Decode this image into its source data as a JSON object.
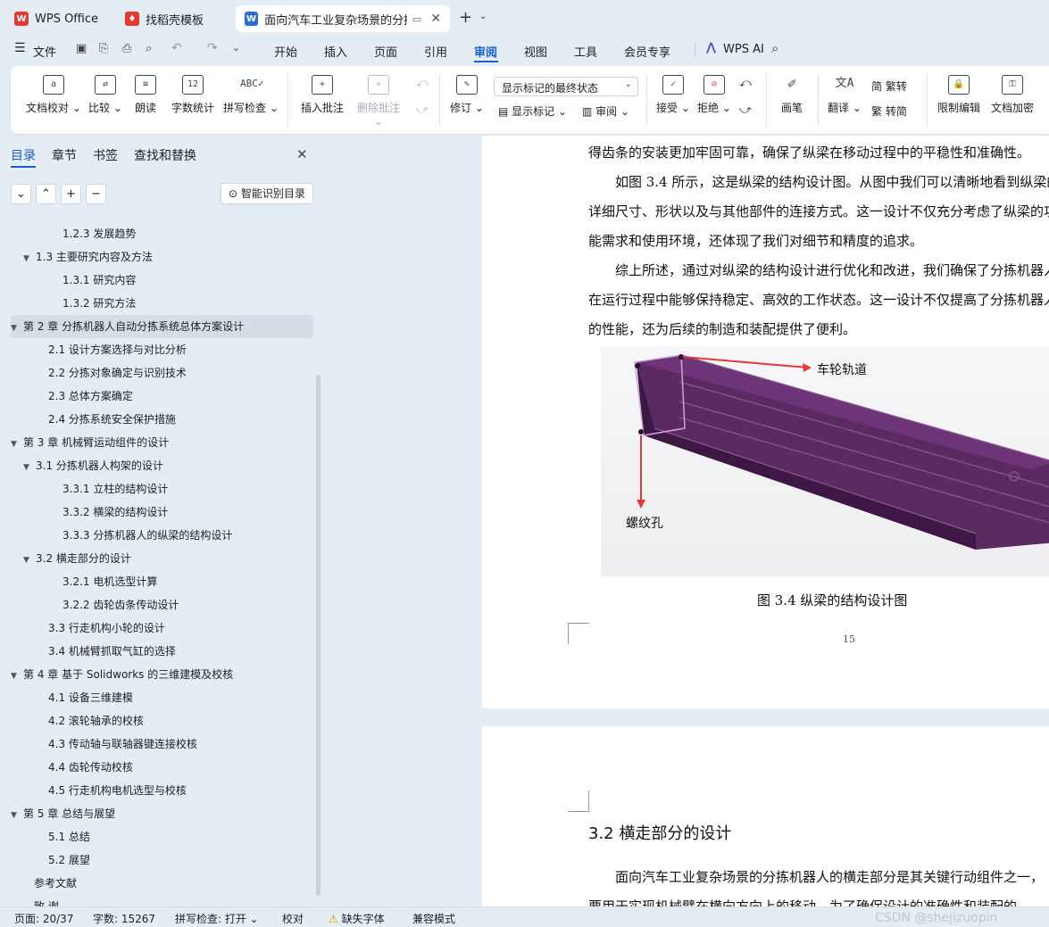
{
  "tabs": [
    {
      "label": "WPS Office"
    },
    {
      "label": "找稻壳模板"
    },
    {
      "label": "面向汽车工业复杂场景的分拣"
    }
  ],
  "menu": {
    "file": "文件",
    "items": [
      "开始",
      "插入",
      "页面",
      "引用",
      "审阅",
      "视图",
      "工具",
      "会员专享"
    ],
    "active": "审阅",
    "ai": "WPS AI"
  },
  "ribbon": {
    "doc_check": "文档校对",
    "compare": "比较",
    "read_aloud": "朗读",
    "word_count": "字数统计",
    "spell_check": "拼写检查",
    "insert_comment": "插入批注",
    "delete_comment": "删除批注",
    "track": "修订",
    "display_state": "显示标记的最终状态",
    "show_markup": "显示标记",
    "review": "审阅",
    "accept": "接受",
    "reject": "拒绝",
    "pen": "画笔",
    "translate": "翻译",
    "to_trad": "繁转",
    "to_simp": "转简",
    "restrict": "限制编辑",
    "encrypt": "文档加密"
  },
  "sidebar": {
    "tabs": [
      "目录",
      "章节",
      "书签",
      "查找和替换"
    ],
    "smart_btn": "智能识别目录",
    "toc": [
      {
        "label": "1.2.3 发展趋势",
        "level": 3
      },
      {
        "label": "1.3 主要研究内容及方法",
        "level": 2,
        "arrow": "▼"
      },
      {
        "label": "1.3.1 研究内容",
        "level": 3
      },
      {
        "label": "1.3.2 研究方法",
        "level": 3
      },
      {
        "label": "第 2 章 分拣机器人自动分拣系统总体方案设计",
        "level": 1,
        "arrow": "▼",
        "selected": true
      },
      {
        "label": "2.1 设计方案选择与对比分析",
        "level": 2
      },
      {
        "label": "2.2 分拣对象确定与识别技术",
        "level": 2
      },
      {
        "label": "2.3 总体方案确定",
        "level": 2
      },
      {
        "label": "2.4 分拣系统安全保护措施",
        "level": 2
      },
      {
        "label": "第 3 章 机械臂运动组件的设计",
        "level": 1,
        "arrow": "▼"
      },
      {
        "label": "3.1 分拣机器人构架的设计",
        "level": 2,
        "arrow": "▼"
      },
      {
        "label": "3.3.1 立柱的结构设计",
        "level": 3
      },
      {
        "label": "3.3.2 横梁的结构设计",
        "level": 3
      },
      {
        "label": "3.3.3 分拣机器人的纵梁的结构设计",
        "level": 3
      },
      {
        "label": "3.2 横走部分的设计",
        "level": 2,
        "arrow": "▼"
      },
      {
        "label": "3.2.1 电机选型计算",
        "level": 3
      },
      {
        "label": "3.2.2 齿轮齿条传动设计",
        "level": 3
      },
      {
        "label": "3.3 行走机构小轮的设计",
        "level": 2
      },
      {
        "label": "3.4 机械臂抓取气缸的选择",
        "level": 2
      },
      {
        "label": "第 4 章 基于 Solidworks 的三维建模及校核",
        "level": 1,
        "arrow": "▼"
      },
      {
        "label": "4.1 设备三维建模",
        "level": 2
      },
      {
        "label": "4.2 滚轮轴承的校核",
        "level": 2
      },
      {
        "label": "4.3 传动轴与联轴器键连接校核",
        "level": 2
      },
      {
        "label": "4.4 齿轮传动校核",
        "level": 2
      },
      {
        "label": "4.5 行走机构电机选型与校核",
        "level": 2
      },
      {
        "label": "第 5 章 总结与展望",
        "level": 1,
        "arrow": "▼"
      },
      {
        "label": "5.1 总结",
        "level": 2
      },
      {
        "label": "5.2 展望",
        "level": 2
      },
      {
        "label": "参考文献",
        "level": 1
      },
      {
        "label": "致 谢",
        "level": 1
      }
    ]
  },
  "doc": {
    "lines": [
      "得齿条的安装更加牢固可靠，确保了纵梁在移动过程中的平稳性和准确性。",
      "　　如图 3.4 所示，这是纵梁的结构设计图。从图中我们可以清晰地看到纵梁的",
      "详细尺寸、形状以及与其他部件的连接方式。这一设计不仅充分考虑了纵梁的功",
      "能需求和使用环境，还体现了我们对细节和精度的追求。",
      "　　综上所述，通过对纵梁的结构设计进行优化和改进，我们确保了分拣机器人",
      "在运行过程中能够保持稳定、高效的工作状态。这一设计不仅提高了分拣机器人",
      "的性能，还为后续的制造和装配提供了便利。"
    ],
    "figure_label_rail": "车轮轨道",
    "figure_label_hole": "螺纹孔",
    "figure_caption": "图 3.4 纵梁的结构设计图",
    "page_number": "15",
    "heading": "3.2  横走部分的设计",
    "next_lines": [
      "　　面向汽车工业复杂场景的分拣机器人的横走部分是其关键行动组件之一，",
      "要用于实现机械臂在横向方向上的移动。为了确保设计的准确性和装配的"
    ]
  },
  "status": {
    "page": "页面: 20/37",
    "words": "字数: 15267",
    "spell": "拼写检查: 打开",
    "proof": "校对",
    "missing_font": "缺失字体",
    "compat": "兼容模式",
    "watermark": "CSDN @shejizuopin"
  },
  "colors": {
    "accent": "#1a5fd0",
    "beam": "#5b2a63",
    "wps_red": "#e8382f"
  }
}
